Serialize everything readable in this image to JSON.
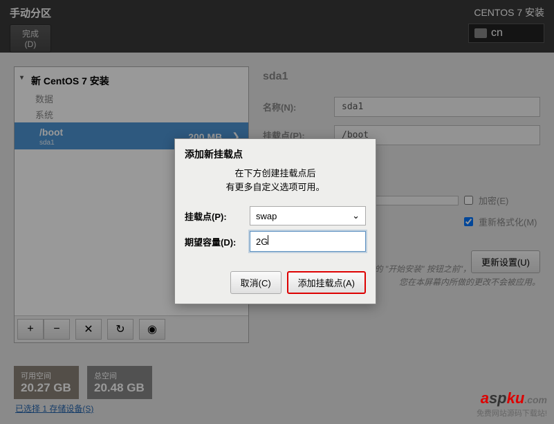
{
  "header": {
    "title": "手动分区",
    "done": "完成(D)",
    "install_title": "CENTOS 7 安装",
    "lang": "cn"
  },
  "left": {
    "install_name": "新 CentOS 7 安装",
    "cat_data": "数据",
    "cat_system": "系统",
    "partition": {
      "name": "/boot",
      "dev": "sda1",
      "size": "200 MB"
    }
  },
  "right": {
    "device": "sda1",
    "name_label": "名称(N):",
    "name_val": "sda1",
    "mount_label": "挂载点(P):",
    "mount_val": "/boot",
    "encrypt_label": "加密(E)",
    "reformat_label": "重新格式化(M)",
    "update": "更新设置(U)",
    "note1": "注意：在您点击主菜单上的 \"开始安装\" 按钮之前\"，",
    "note2": "您在本屏幕内所做的更改不会被应用。"
  },
  "space": {
    "free_label": "可用空间",
    "free_val": "20.27 GB",
    "total_label": "总空间",
    "total_val": "20.48 GB"
  },
  "devices_link": "已选择 1 存储设备(S)",
  "dialog": {
    "title": "添加新挂载点",
    "sub1": "在下方创建挂载点后",
    "sub2": "有更多自定义选项可用。",
    "mount_label": "挂载点(P):",
    "mount_val": "swap",
    "size_label": "期望容量(D):",
    "size_val": "2G",
    "cancel": "取消(C)",
    "add": "添加挂载点(A)"
  },
  "watermark": {
    "sub": "免费网站源码下载站!"
  }
}
